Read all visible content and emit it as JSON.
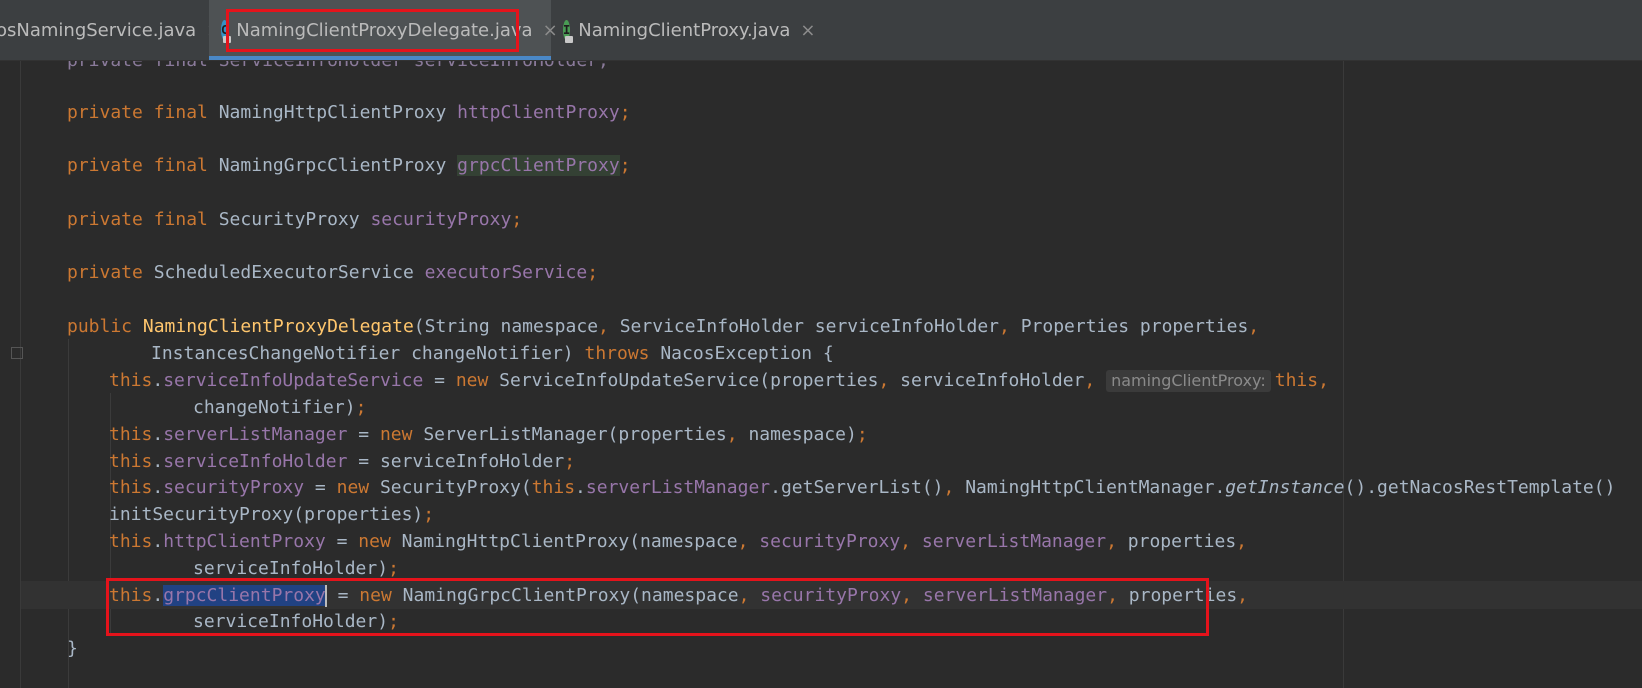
{
  "tabs": [
    {
      "label": "osNamingService.java",
      "close": "×"
    },
    {
      "label": "NamingClientProxyDelegate.java",
      "close": "×",
      "icon_letter": "C"
    },
    {
      "label": "NamingClientProxy.java",
      "close": "×",
      "icon_letter": "I"
    }
  ],
  "colors": {
    "keyword": "#cc7832",
    "field": "#9876aa",
    "method_decl": "#ffc66d",
    "text": "#a9b7c6",
    "highlight_box": "#e5131b",
    "selection": "#214283"
  },
  "icons": {
    "class_tab": "class-lock-icon",
    "interface_tab": "interface-lock-icon"
  },
  "code": {
    "l0": {
      "a": "private final ServiceInfoHolder serviceInfoHolder;"
    },
    "l1": {
      "k": "private final ",
      "t": "NamingHttpClientProxy ",
      "f": "httpClientProxy",
      "e": ";"
    },
    "l2": {
      "k": "private final ",
      "t": "NamingGrpcClientProxy ",
      "f": "grpcClientProxy",
      "e": ";"
    },
    "l3": {
      "k": "private final ",
      "t": "SecurityProxy ",
      "f": "securityProxy",
      "e": ";"
    },
    "l4": {
      "k": "private ",
      "t": "ScheduledExecutorService ",
      "f": "executorService",
      "e": ";"
    },
    "l5": {
      "k": "public ",
      "m": "NamingClientProxyDelegate",
      "a": "(String namespace",
      "c": ", ",
      "b": "ServiceInfoHolder serviceInfoHolder",
      "c2": ", ",
      "d": "Properties properties",
      "c3": ","
    },
    "l6": {
      "a": "InstancesChangeNotifier changeNotifier) ",
      "k": "throws ",
      "b": "NacosException {"
    },
    "l7": {
      "k": "this",
      "dot": ".",
      "f": "serviceInfoUpdateService",
      "eq": " = ",
      "n": "new ",
      "a": "ServiceInfoUpdateService(properties",
      "c": ", ",
      "b": "serviceInfoHolder",
      "c2": ", ",
      "hint": "namingClientProxy:",
      "t": "this",
      "c3": ","
    },
    "l8": {
      "a": "changeNotifier)",
      "s": ";"
    },
    "l9": {
      "k": "this",
      "dot": ".",
      "f": "serverListManager",
      "eq": " = ",
      "n": "new ",
      "a": "ServerListManager(properties",
      "c": ", ",
      "b": "namespace)",
      "s": ";"
    },
    "l10": {
      "k": "this",
      "dot": ".",
      "f": "serviceInfoHolder",
      "eq": " = serviceInfoHolder",
      "s": ";"
    },
    "l11": {
      "k": "this",
      "dot": ".",
      "f": "securityProxy",
      "eq": " = ",
      "n": "new ",
      "a": "SecurityProxy(",
      "t": "this",
      "dot2": ".",
      "f2": "serverListManager",
      "b": ".getServerList()",
      "c": ", ",
      "d": "NamingHttpClientManager.",
      "i": "getInstance",
      "e": "().getNacosRestTemplate()"
    },
    "l12": {
      "a": "initSecurityProxy(properties)",
      "s": ";"
    },
    "l13": {
      "k": "this",
      "dot": ".",
      "f": "httpClientProxy",
      "eq": " = ",
      "n": "new ",
      "a": "NamingHttpClientProxy(namespace",
      "c": ", ",
      "f2": "securityProxy",
      "c2": ", ",
      "f3": "serverListManager",
      "c3": ", ",
      "b": "properties",
      "c4": ","
    },
    "l14": {
      "a": "serviceInfoHolder)",
      "s": ";"
    },
    "l15": {
      "k": "this",
      "dot": ".",
      "f": "grpcClientProxy",
      "eq": " = ",
      "n": "new ",
      "a": "NamingGrpcClientProxy(namespace",
      "c": ", ",
      "f2": "securityProxy",
      "c2": ", ",
      "f3": "serverListManager",
      "c3": ", ",
      "b": "properties",
      "c4": ","
    },
    "l16": {
      "a": "serviceInfoHolder)",
      "s": ";"
    },
    "l17": {
      "a": "}"
    }
  }
}
